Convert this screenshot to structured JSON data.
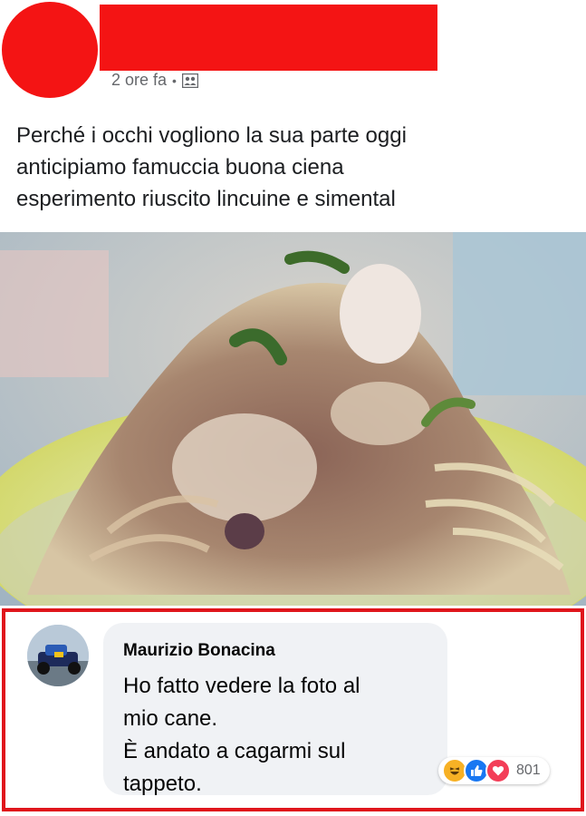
{
  "post": {
    "time": "2 ore fa",
    "separator": "•",
    "privacy_icon": "friends-icon",
    "text_lines": [
      "Perché i occhi vogliono la sua parte oggi",
      "anticipiamo famuccia buona ciena",
      "esperimento riuscito lincuine e simental"
    ]
  },
  "comment": {
    "author": "Maurizio Bonacina",
    "text_lines": [
      "Ho fatto vedere la foto al",
      "mio cane.",
      "È andato a cagarmi sul",
      "tappeto."
    ],
    "reactions": {
      "icons": [
        "haha-icon",
        "like-icon",
        "love-icon"
      ],
      "count": "801"
    }
  },
  "colors": {
    "redaction": "#f41414",
    "frame": "#e0151b",
    "like": "#1877f2",
    "love": "#f33e58",
    "haha": "#f7b125"
  }
}
